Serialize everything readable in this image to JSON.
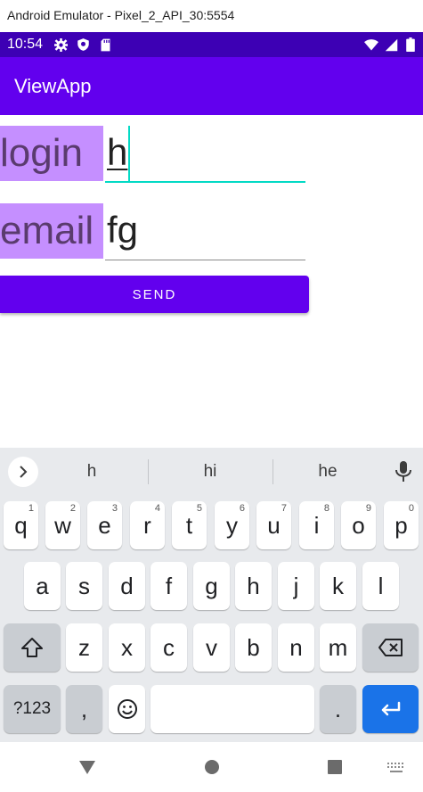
{
  "window": {
    "title": "Android Emulator - Pixel_2_API_30:5554"
  },
  "status_bar": {
    "time": "10:54"
  },
  "app_bar": {
    "title": "ViewApp"
  },
  "form": {
    "login_label": "login",
    "login_value": "h",
    "email_label": "email",
    "email_value": "fg",
    "send_label": "SEND"
  },
  "keyboard": {
    "suggestions": [
      "h",
      "hi",
      "he"
    ],
    "row1": [
      {
        "k": "q",
        "n": "1"
      },
      {
        "k": "w",
        "n": "2"
      },
      {
        "k": "e",
        "n": "3"
      },
      {
        "k": "r",
        "n": "4"
      },
      {
        "k": "t",
        "n": "5"
      },
      {
        "k": "y",
        "n": "6"
      },
      {
        "k": "u",
        "n": "7"
      },
      {
        "k": "i",
        "n": "8"
      },
      {
        "k": "o",
        "n": "9"
      },
      {
        "k": "p",
        "n": "0"
      }
    ],
    "row2": [
      "a",
      "s",
      "d",
      "f",
      "g",
      "h",
      "j",
      "k",
      "l"
    ],
    "row3": [
      "z",
      "x",
      "c",
      "v",
      "b",
      "n",
      "m"
    ],
    "symbols_label": "?123",
    "comma_label": ",",
    "period_label": "."
  },
  "colors": {
    "status_bar": "#3d00b4",
    "app_bar": "#6200ee",
    "label_bg": "#c58fff",
    "focus_underline": "#03dac5",
    "enter_key": "#1a73e8"
  }
}
